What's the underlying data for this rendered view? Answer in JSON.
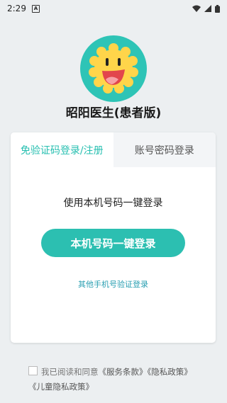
{
  "status_bar": {
    "time": "2:29",
    "notification_badge": "A",
    "icons": [
      "wifi-icon",
      "signal-icon",
      "battery-icon"
    ]
  },
  "app": {
    "title": "昭阳医生(患者版)",
    "logo_colors": {
      "ring": "#2ec4b6",
      "sun": "#ffd54a",
      "mouth": "#e2464c"
    }
  },
  "tabs": [
    {
      "label": "免验证码登录/注册",
      "active": true
    },
    {
      "label": "账号密码登录",
      "active": false
    }
  ],
  "login": {
    "prompt": "使用本机号码一键登录",
    "button_label": "本机号码一键登录",
    "alt_link": "其他手机号验证登录"
  },
  "agreement": {
    "checked": false,
    "prefix": "我已阅读和同意",
    "service_terms": "《服务条款》",
    "privacy_policy": "《隐私政策》",
    "child_privacy": "《儿童隐私政策》"
  },
  "colors": {
    "accent": "#2cbfb1",
    "link": "#2a9fb2",
    "background": "#eceff1"
  }
}
